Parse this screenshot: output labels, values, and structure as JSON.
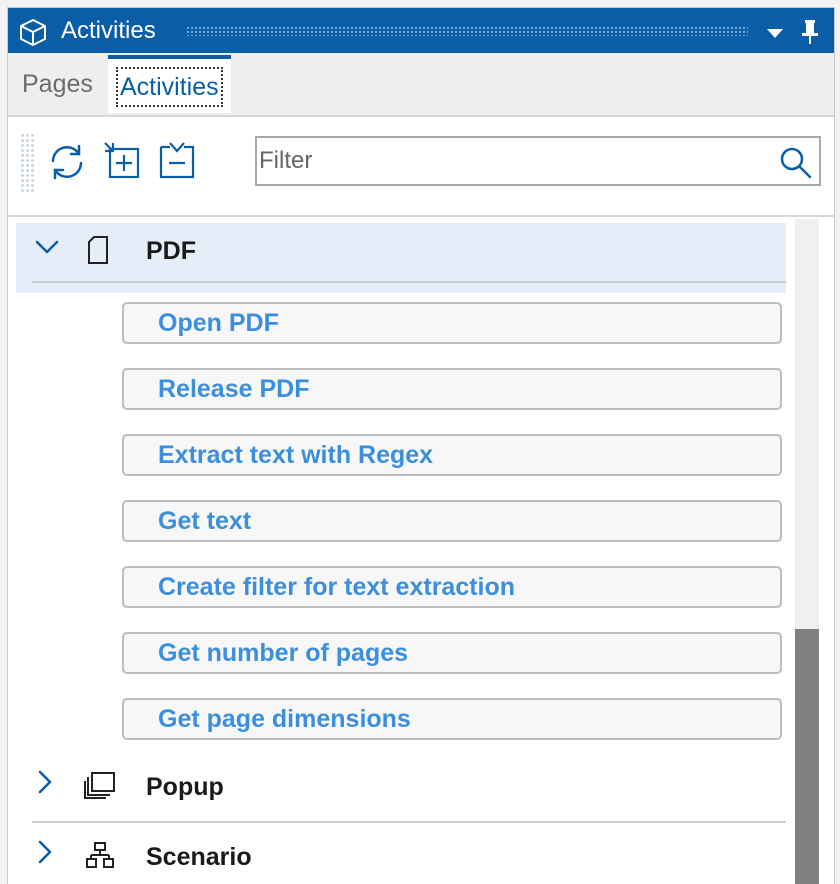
{
  "window": {
    "title": "Activities"
  },
  "tabs": [
    {
      "label": "Pages",
      "active": false
    },
    {
      "label": "Activities",
      "active": true
    }
  ],
  "toolbar": {
    "refresh_icon": "refresh-icon",
    "expand_icon": "expand-all-icon",
    "collapse_icon": "collapse-all-icon"
  },
  "filter": {
    "placeholder": "Filter",
    "value": ""
  },
  "tree": {
    "groups": [
      {
        "label": "PDF",
        "expanded": true,
        "icon": "document-icon",
        "items": [
          {
            "label": "Open PDF"
          },
          {
            "label": "Release PDF"
          },
          {
            "label": "Extract text with Regex"
          },
          {
            "label": "Get text"
          },
          {
            "label": "Create filter for text extraction"
          },
          {
            "label": "Get number of pages"
          },
          {
            "label": "Get page dimensions"
          }
        ]
      },
      {
        "label": "Popup",
        "expanded": false,
        "icon": "popup-icon"
      },
      {
        "label": "Scenario",
        "expanded": false,
        "icon": "scenario-icon"
      }
    ]
  },
  "colors": {
    "accent": "#0a5ea8",
    "activity_text": "#3b8fdc",
    "selected_row": "#e5eef8"
  }
}
